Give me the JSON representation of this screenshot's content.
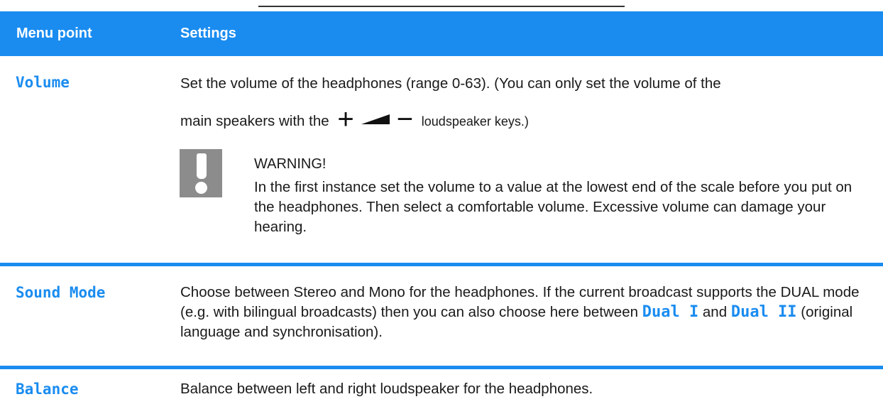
{
  "header": {
    "menu_point": "Menu point",
    "settings": "Settings"
  },
  "rows": [
    {
      "key": "Volume",
      "line1": "Set the volume of the headphones (range 0-63). (You can only set the volume of the",
      "line2_before": "main speakers with the",
      "line2_after": "loudspeaker keys.)",
      "warning_title": "WARNING!",
      "warning_body": "In the first instance set the volume to a value at the lowest end of the scale before you put on the headphones. Then select a comfortable volume. Excessive volume can damage your hearing."
    },
    {
      "key": "Sound Mode",
      "text_before": "Choose between Stereo and Mono for the headphones. If the current broadcast supports the DUAL mode (e.g. with bilingual broadcasts) then you can also choose here between",
      "option1": "Dual I",
      "connector": "and",
      "option2": "Dual II",
      "text_after": "(original language and synchronisation)."
    },
    {
      "key": "Balance",
      "text": "Balance between left and right loudspeaker for the headphones."
    }
  ],
  "colors": {
    "accent": "#1a8cf0",
    "warning_icon": "#8c8c8c"
  },
  "icons": {
    "speaker_keys": [
      "plus-icon",
      "volume-wedge-icon",
      "minus-icon"
    ],
    "warning": "exclamation-icon"
  }
}
